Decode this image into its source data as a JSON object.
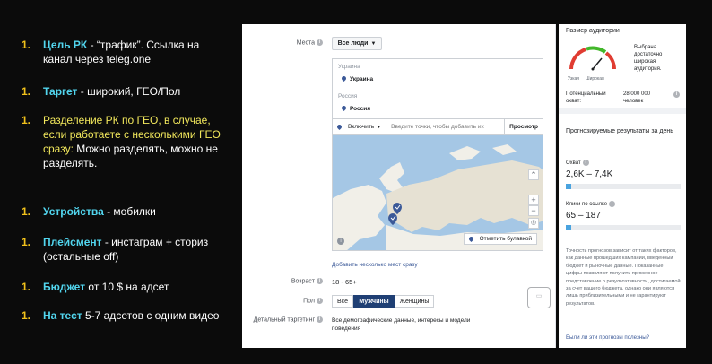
{
  "left": {
    "items": [
      {
        "num": "1.",
        "head": "Цель РК",
        "body": " - “трафик”. Ссылка на канал через teleg.one"
      },
      {
        "num": "1.",
        "head": "Таргет",
        "body": " - широкий, ГЕО/Пол"
      },
      {
        "num": "1.",
        "yellow": "Разделение РК по ГЕО, в случае, если работаете с несколькими ГЕО сразу:",
        "white": " Можно разделять, можно не разделять."
      },
      {
        "num": "1.",
        "head": "Устройства",
        "body": " - мобилки"
      },
      {
        "num": "1.",
        "head": "Плейсмент",
        "body": " - инстаграм + сториз (остальные off)"
      },
      {
        "num": "1.",
        "head": "Бюджет",
        "body": " от 10 $ на адсет"
      },
      {
        "num": "1.",
        "head": "На тест",
        "body": " 5-7 адсетов с одним видео"
      }
    ]
  },
  "panel": {
    "places_label": "Места",
    "places_value": "Все люди",
    "country1": "Украина",
    "place1": "Украина",
    "country2": "Россия",
    "place2": "Россия",
    "include_label": "Включить",
    "search_placeholder": "Введите точки, чтобы добавить их",
    "browse_label": "Просмотр",
    "drop_pin": "Отметить булавкой",
    "add_many": "Добавить несколько мест сразу",
    "age_label": "Возраст",
    "age_value": "18 - 65+",
    "gender_label": "Пол",
    "gender_options": [
      "Все",
      "Мужчины",
      "Женщины"
    ],
    "detailed_label": "Детальный таргетинг",
    "detailed_value": "Все демографические данные, интересы и модели поведения"
  },
  "audience": {
    "title": "Размер аудитории",
    "desc": "Выбрана достаточно широкая аудитория.",
    "narrow": "Узкая",
    "wide": "Широкая",
    "potential_label": "Потенциальный охват:",
    "potential_value": "28 000 000 человек"
  },
  "estimates": {
    "title": "Прогнозируемые результаты за день",
    "reach_label": "Охват",
    "reach_value": "2,6K – 7,4K",
    "reach_fill": 0.05,
    "clicks_label": "Клики по ссылке",
    "clicks_value": "65 – 187",
    "clicks_fill": 0.05,
    "note": "Точность прогнозов зависит от таких факторов, как данные прошедших кампаний, введенный бюджет и рыночные данные. Показанные цифры позволяют получить примерное представление о результативности, достигаемой за счет вашего бюджета, однако они являются лишь приблизительными и не гарантируют результатов.",
    "feedback": "Были ли эти прогнозы полезны?"
  },
  "colors": {
    "accent": "#52d6ef",
    "number": "#f2c21b",
    "yellow": "#f2e85c",
    "fb_blue": "#3b5998",
    "selected": "#1f3f74"
  }
}
